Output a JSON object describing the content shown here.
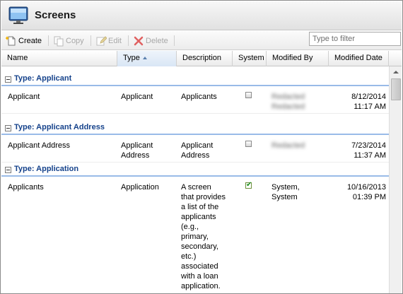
{
  "title": "Screens",
  "toolbar": {
    "create": "Create",
    "copy": "Copy",
    "edit": "Edit",
    "delete": "Delete",
    "filter_placeholder": "Type to filter"
  },
  "columns": {
    "name": "Name",
    "type": "Type",
    "description": "Description",
    "system": "System",
    "modified_by": "Modified By",
    "modified_date": "Modified Date"
  },
  "groups": [
    {
      "label": "Type: Applicant",
      "rows": [
        {
          "name": "Applicant",
          "type": "Applicant",
          "description": "Applicants",
          "system": false,
          "modified_by": [
            "Redacted",
            "Redacted"
          ],
          "modified_date": [
            "8/12/2014",
            "11:17 AM"
          ]
        }
      ]
    },
    {
      "label": "Type: Applicant Address",
      "rows": [
        {
          "name": "Applicant Address",
          "type": [
            "Applicant",
            "Address"
          ],
          "description": [
            "Applicant",
            "Address"
          ],
          "system": false,
          "modified_by": [
            "Redacted"
          ],
          "modified_date": [
            "7/23/2014",
            "11:37 AM"
          ]
        }
      ]
    },
    {
      "label": "Type: Application",
      "rows": [
        {
          "name": "Applicants",
          "type": "Application",
          "description": [
            "A screen",
            "that provides",
            "a list of the",
            "applicants",
            "(e.g.,",
            "primary,",
            "secondary,",
            "etc.)",
            "associated",
            "with a loan",
            "application."
          ],
          "system": true,
          "modified_by": [
            "System,",
            "System"
          ],
          "modified_date": [
            "10/16/2013",
            "01:39 PM"
          ]
        }
      ]
    }
  ]
}
